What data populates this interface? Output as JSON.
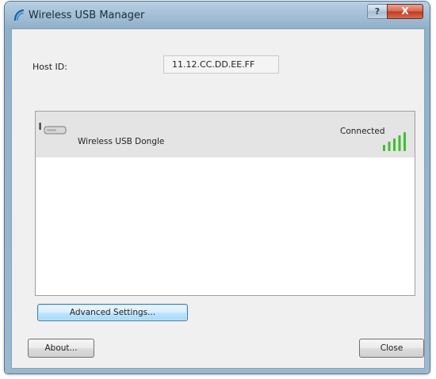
{
  "window": {
    "title": "Wireless USB Manager",
    "help_label": "?",
    "close_label": "X"
  },
  "host": {
    "label": "Host ID:",
    "value": "11.12.CC.DD.EE.FF"
  },
  "devices": [
    {
      "icon": "usb-dongle-icon",
      "name": "Wireless USB Dongle",
      "status": "Connected",
      "signal_bars": 5,
      "signal_color": "#3fbf2f"
    }
  ],
  "buttons": {
    "advanced": "Advanced Settings...",
    "about": "About...",
    "close": "Close"
  },
  "colors": {
    "selection_row": "#e4e4e4",
    "focus_border": "#3c7fb1",
    "caption_close": "#c0391f"
  }
}
